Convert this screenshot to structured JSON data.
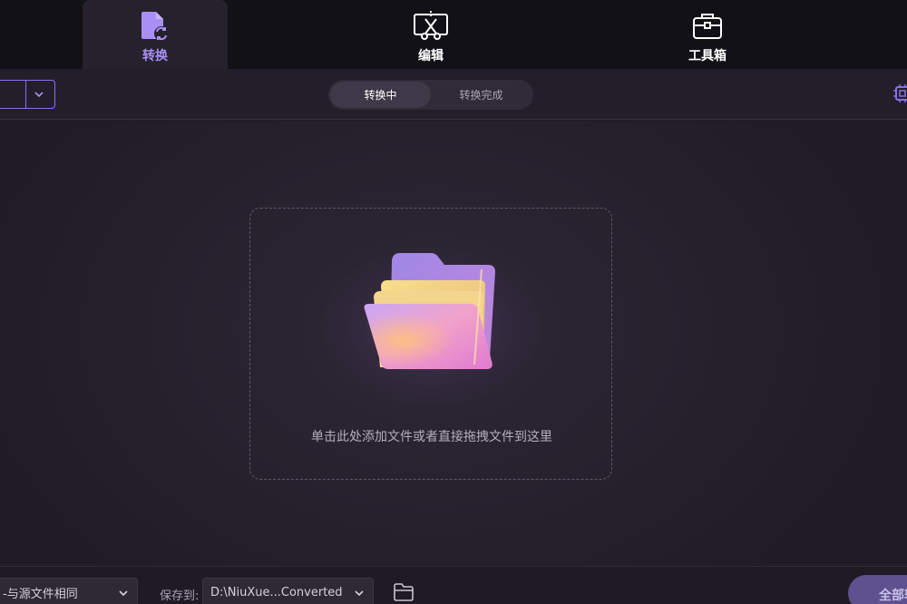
{
  "nav": {
    "tabs": [
      {
        "label": "转换",
        "icon": "convert-file-icon",
        "active": true
      },
      {
        "label": "编辑",
        "icon": "edit-cut-icon",
        "active": false
      },
      {
        "label": "工具箱",
        "icon": "toolbox-icon",
        "active": false
      }
    ]
  },
  "toolbar": {
    "segments": [
      {
        "label": "转换中",
        "active": true
      },
      {
        "label": "转换完成",
        "active": false
      }
    ],
    "right_icon": "cpu-acceleration-icon"
  },
  "dropzone": {
    "icon": "folder-icon",
    "hint": "单击此处添加文件或者直接拖拽文件到这里"
  },
  "bottom": {
    "format_value": "-与源文件相同",
    "save_label": "保存到:",
    "save_path": "D:\\NiuXue...Converted",
    "open_folder_icon": "open-folder-icon",
    "convert_all_label": "全部转换"
  },
  "colors": {
    "accent": "#8b6ff0",
    "active_tab_text": "#a98ff5",
    "background": "#201c27",
    "topbar": "#131118"
  }
}
